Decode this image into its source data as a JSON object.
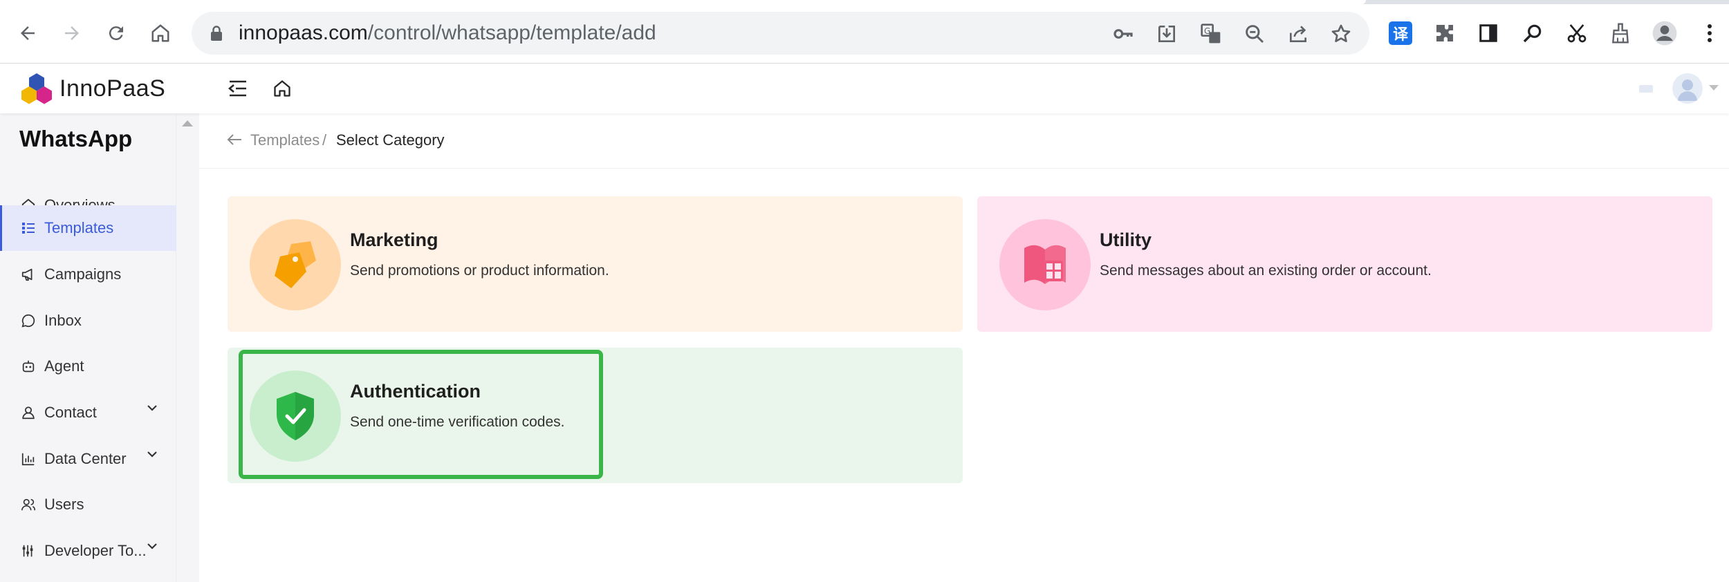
{
  "browser": {
    "url_host": "innopaas.com",
    "url_path": "/control/whatsapp/template/add",
    "translate_badge": "译",
    "nav_icons": [
      "back-icon",
      "forward-icon",
      "reload-icon",
      "home-icon"
    ],
    "omnibox_icons": [
      "key-icon",
      "install-icon",
      "translate-page-icon",
      "zoom-out-icon",
      "share-icon",
      "bookmark-star-icon"
    ],
    "toolbar_icons": [
      "translate-extension-icon",
      "extensions-puzzle-icon",
      "side-panel-icon",
      "search-extension-icon",
      "scissors-icon",
      "broom-icon",
      "profile-icon",
      "kebab-menu-icon"
    ]
  },
  "app": {
    "logo_text": "InnoPaaS",
    "header_icons": [
      "menu-fold-icon",
      "home-icon",
      "language-flag-icon",
      "avatar-icon",
      "caret-down-icon"
    ]
  },
  "sidebar": {
    "title": "WhatsApp",
    "items": [
      {
        "label": "Overviews",
        "icon": "home-icon",
        "active": false,
        "expandable": false
      },
      {
        "label": "Templates",
        "icon": "list-icon",
        "active": true,
        "expandable": false
      },
      {
        "label": "Campaigns",
        "icon": "megaphone-icon",
        "active": false,
        "expandable": false
      },
      {
        "label": "Inbox",
        "icon": "chat-icon",
        "active": false,
        "expandable": false
      },
      {
        "label": "Agent",
        "icon": "robot-icon",
        "active": false,
        "expandable": false
      },
      {
        "label": "Contact",
        "icon": "user-icon",
        "active": false,
        "expandable": true
      },
      {
        "label": "Data Center",
        "icon": "bar-chart-icon",
        "active": false,
        "expandable": true
      },
      {
        "label": "Users",
        "icon": "users-icon",
        "active": false,
        "expandable": false
      },
      {
        "label": "Developer To...",
        "icon": "tools-icon",
        "active": false,
        "expandable": true
      }
    ]
  },
  "breadcrumb": {
    "parent": "Templates",
    "separator": "/",
    "current": "Select Category"
  },
  "categories": {
    "marketing": {
      "title": "Marketing",
      "desc": "Send promotions or product information.",
      "icon": "price-tags-icon",
      "color": "#f5a623"
    },
    "utility": {
      "title": "Utility",
      "desc": "Send messages about an existing order or account.",
      "icon": "book-icon",
      "color": "#f05a8a"
    },
    "auth": {
      "title": "Authentication",
      "desc": "Send one-time verification codes.",
      "icon": "shield-check-icon",
      "color": "#2fb84a",
      "highlighted": true
    }
  },
  "colors": {
    "accent": "#3b5bdb",
    "highlight_border": "#3ab54a"
  }
}
